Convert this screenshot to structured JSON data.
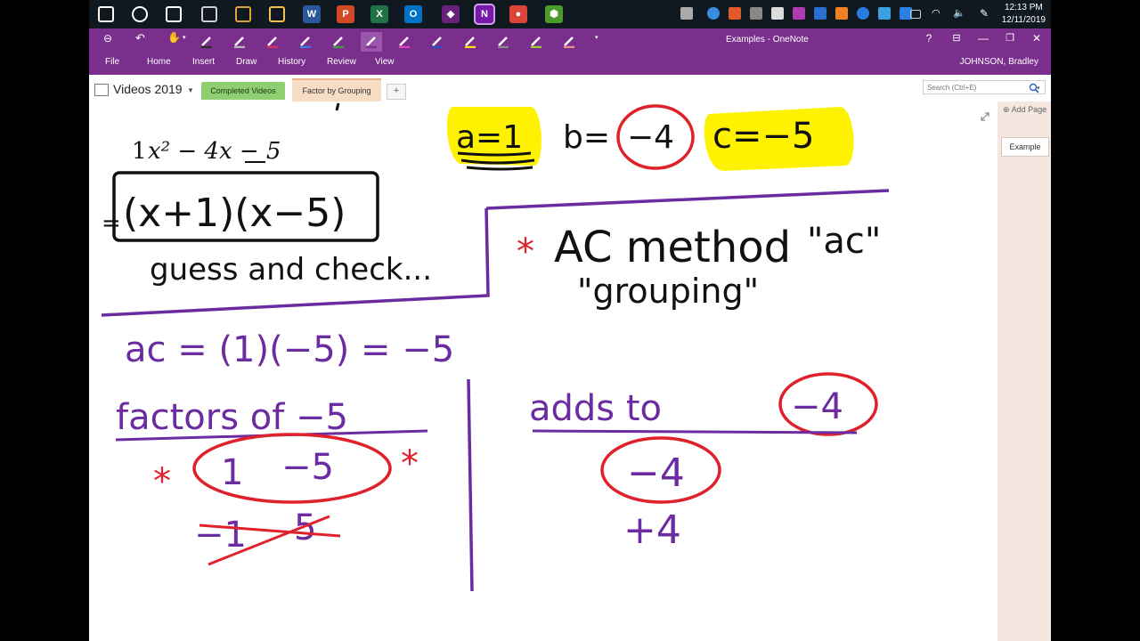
{
  "taskbar": {
    "time": "12:13 PM",
    "date": "12/11/2019",
    "apps": [
      {
        "name": "windows-start-icon",
        "color": "#ffffff"
      },
      {
        "name": "cortana-icon",
        "color": "#ffffff"
      },
      {
        "name": "task-view-icon",
        "color": "#ffffff"
      },
      {
        "name": "calculator-icon",
        "color": "#d0d0d0"
      },
      {
        "name": "paint-icon",
        "color": "#e0a040"
      },
      {
        "name": "file-explorer-icon",
        "color": "#f2c24c"
      },
      {
        "name": "word-icon",
        "color": "#2b579a",
        "glyph": "W"
      },
      {
        "name": "powerpoint-icon",
        "color": "#d24726",
        "glyph": "P"
      },
      {
        "name": "excel-icon",
        "color": "#217346",
        "glyph": "X"
      },
      {
        "name": "outlook-icon",
        "color": "#0072c6",
        "glyph": "O"
      },
      {
        "name": "visual-studio-icon",
        "color": "#68217a",
        "glyph": "◆"
      },
      {
        "name": "onenote-icon",
        "color": "#7719aa",
        "glyph": "N"
      },
      {
        "name": "chrome-icon",
        "color": "#db4437",
        "glyph": "●"
      },
      {
        "name": "geogebra-icon",
        "color": "#4c9a2a",
        "glyph": "⬢"
      }
    ]
  },
  "window": {
    "title": "Examples - OneNote",
    "user": "JOHNSON, Bradley",
    "help": "?",
    "minimize": "—",
    "maximize": "❐",
    "close": "✕"
  },
  "ribbon": {
    "tabs": [
      "File",
      "Home",
      "Insert",
      "Draw",
      "History",
      "Review",
      "View"
    ],
    "pens": [
      "#ffffff",
      "#ffffff",
      "#ffffff",
      "#2a2a2a",
      "#bbbbbb",
      "#d6315b",
      "#3d7bd9",
      "#3d9c3d",
      "#7a2f8d",
      "#e040c0",
      "#3050c0",
      "#ffe000",
      "#888888",
      "#9acd32",
      "#e89090"
    ]
  },
  "notebook": {
    "name": "Videos 2019",
    "sections": [
      "Completed Videos",
      "Factor by Grouping"
    ],
    "add_section": "+",
    "search_placeholder": "Search (Ctrl+E)"
  },
  "pages": {
    "add_page": "Add Page",
    "items": [
      "Example"
    ]
  },
  "note": {
    "expression": "1x² − 4x − 5",
    "expr_coef": "1",
    "expr_rest": "x² − 4x − 5",
    "factored": "(x+1)(x−5)",
    "equals": "=",
    "guess_check": "guess and check...",
    "a_label": "a=1",
    "b_label": "b=",
    "b_value": "−4",
    "c_label": "c=−5",
    "star": "*",
    "ac_method": "AC method",
    "ac_quote": "\"ac\"",
    "grouping": "\"grouping\"",
    "ac_calc": "ac = (1)(−5) = −5",
    "factors_header": "factors of −5",
    "adds_header": "adds to",
    "adds_value": "−4",
    "pair1_a": "1",
    "pair1_b": "−5",
    "pair2_a": "−1",
    "pair2_b": "5",
    "sum1": "−4",
    "sum2": "+4"
  },
  "colors": {
    "ribbon": "#7a2f8d",
    "ink_black": "#111111",
    "ink_purple": "#6a2ca0",
    "ink_red": "#e0202a",
    "highlight": "#fff200",
    "section_green": "#8fcf72",
    "section_peach": "#f7dcc6"
  }
}
